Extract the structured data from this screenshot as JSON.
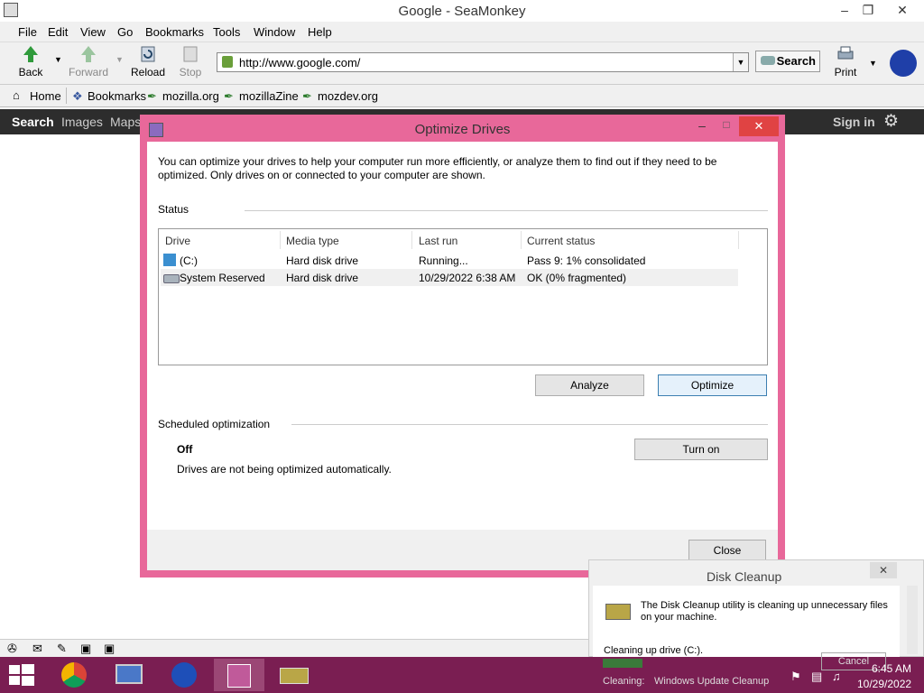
{
  "app": {
    "title": "Google - SeaMonkey",
    "menu": [
      "File",
      "Edit",
      "View",
      "Go",
      "Bookmarks",
      "Tools",
      "Window",
      "Help"
    ],
    "nav": {
      "back": "Back",
      "forward": "Forward",
      "reload": "Reload",
      "stop": "Stop",
      "url": "http://www.google.com/",
      "search": "Search",
      "print": "Print"
    },
    "bookmarks": [
      "Home",
      "Bookmarks",
      "mozilla.org",
      "mozillaZine",
      "mozdev.org"
    ]
  },
  "google_bar": {
    "items": [
      "Search",
      "Images",
      "Maps"
    ],
    "sign_in": "Sign in"
  },
  "dialog": {
    "title": "Optimize Drives",
    "intro": "You can optimize your drives to help your computer run more efficiently, or analyze them to find out if they need to be optimized. Only drives on or connected to your computer are shown.",
    "status_label": "Status",
    "columns": [
      "Drive",
      "Media type",
      "Last run",
      "Current status"
    ],
    "rows": [
      {
        "drive": "(C:)",
        "media": "Hard disk drive",
        "last_run": "Running...",
        "status": "Pass 9: 1% consolidated"
      },
      {
        "drive": "System Reserved",
        "media": "Hard disk drive",
        "last_run": "10/29/2022 6:38 AM",
        "status": "OK (0% fragmented)"
      }
    ],
    "analyze": "Analyze",
    "optimize": "Optimize",
    "scheduled_label": "Scheduled optimization",
    "sched_state": "Off",
    "sched_desc": "Drives are not being optimized automatically.",
    "turn_on": "Turn on",
    "close": "Close"
  },
  "disk_cleanup": {
    "title": "Disk Cleanup",
    "message": "The Disk Cleanup utility is cleaning up unnecessary files on your machine.",
    "cleaning_drive": "Cleaning up drive  (C:).",
    "cancel": "Cancel",
    "cleaning_label": "Cleaning:",
    "cleaning_item": "Windows Update Cleanup"
  },
  "taskbar": {
    "time": "6:45 AM",
    "date": "10/29/2022"
  },
  "colors": {
    "dialog_frame": "#e8689a",
    "taskbar": "#7a1e52",
    "google_bar": "#2d2d2d"
  }
}
